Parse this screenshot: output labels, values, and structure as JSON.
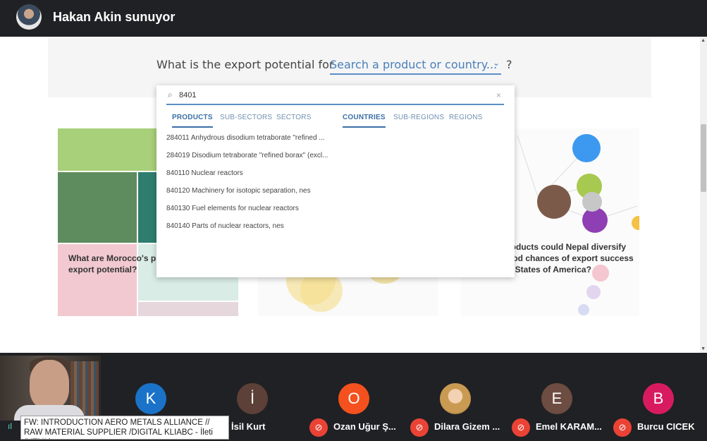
{
  "meeting": {
    "presenter_title": "Hakan Akin sunuyor"
  },
  "page": {
    "question_prefix": "What is the export potential for",
    "search_select": "Search a product or country...",
    "question_suffix": "?",
    "search_value": "8401",
    "tabs_left": [
      "PRODUCTS",
      "SUB-SECTORS",
      "SECTORS"
    ],
    "tabs_right": [
      "COUNTRIES",
      "SUB-REGIONS",
      "REGIONS"
    ],
    "active_tab_left": "PRODUCTS",
    "active_tab_right": "COUNTRIES",
    "results": [
      "284011 Anhydrous disodium tetraborate \"refined ...",
      "284019 Disodium tetraborate \"refined borax\" (excl...",
      "840110 Nuclear reactors",
      "840120 Machinery for isotopic separation, nes",
      "840130 Fuel elements for nuclear reactors",
      "840140 Parts of nuclear reactors, nes"
    ],
    "card_left_text": "What are Morocco's pro export potential?",
    "card_right_text": "roducts could Nepal diversify ood chances of export success d States of America?"
  },
  "participants": [
    {
      "initial": "K",
      "name": "",
      "color": "#1a73c8"
    },
    {
      "initial": "İ",
      "name": "İsil Kurt",
      "color": "#5d4037"
    },
    {
      "initial": "O",
      "name": "Ozan Uğur Ş...",
      "color": "#f4511e"
    },
    {
      "initial": "",
      "name": "Dilara Gizem ...",
      "color": "#d7b98e"
    },
    {
      "initial": "E",
      "name": "Emel KARAM...",
      "color": "#6d4c41"
    },
    {
      "initial": "B",
      "name": "Burcu CICEK",
      "color": "#d81b60"
    }
  ],
  "tooltip": "FW: INTRODUCTION AERO METALS ALLIANCE // RAW MATERIAL SUPPLIER /DIGITAL KLIABC - İleti (HTML)",
  "icons": {
    "search": "search-icon",
    "clear": "close-icon",
    "mic_off": "mic-off-icon",
    "sound": "audio-level-icon"
  }
}
